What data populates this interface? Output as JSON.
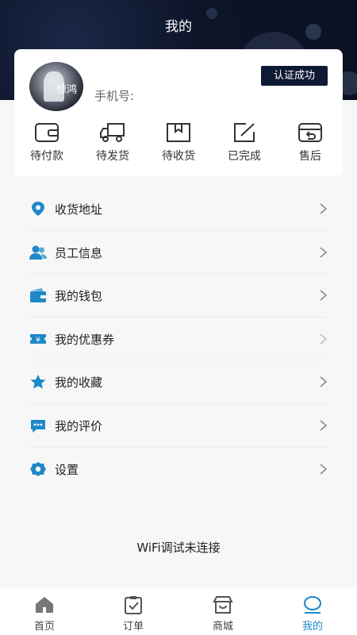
{
  "header": {
    "title": "我的"
  },
  "profile": {
    "phone_label": "手机号:",
    "cert_badge": "认证成功",
    "avatar_text": "惊鸿"
  },
  "orders": [
    {
      "label": "待付款",
      "icon": "wallet-icon"
    },
    {
      "label": "待发货",
      "icon": "truck-icon"
    },
    {
      "label": "待收货",
      "icon": "package-icon"
    },
    {
      "label": "已完成",
      "icon": "edit-icon"
    },
    {
      "label": "售后",
      "icon": "return-icon"
    }
  ],
  "menu": [
    {
      "label": "收货地址",
      "icon": "location-pin-icon"
    },
    {
      "label": "员工信息",
      "icon": "users-icon"
    },
    {
      "label": "我的钱包",
      "icon": "wallet-icon"
    },
    {
      "label": "我的优惠券",
      "icon": "coupon-icon"
    },
    {
      "label": "我的收藏",
      "icon": "star-icon"
    },
    {
      "label": "我的评价",
      "icon": "comment-icon"
    },
    {
      "label": "设置",
      "icon": "gear-icon"
    }
  ],
  "wifi_status": "WiFi调试未连接",
  "tabbar": [
    {
      "label": "首页",
      "icon": "home-icon",
      "active": false
    },
    {
      "label": "订单",
      "icon": "order-icon",
      "active": false
    },
    {
      "label": "商城",
      "icon": "store-icon",
      "active": false
    },
    {
      "label": "我的",
      "icon": "profile-icon",
      "active": true
    }
  ],
  "colors": {
    "header_bg": "#0c1428",
    "accent": "#1e88c8",
    "badge_bg": "#0e1a33"
  }
}
